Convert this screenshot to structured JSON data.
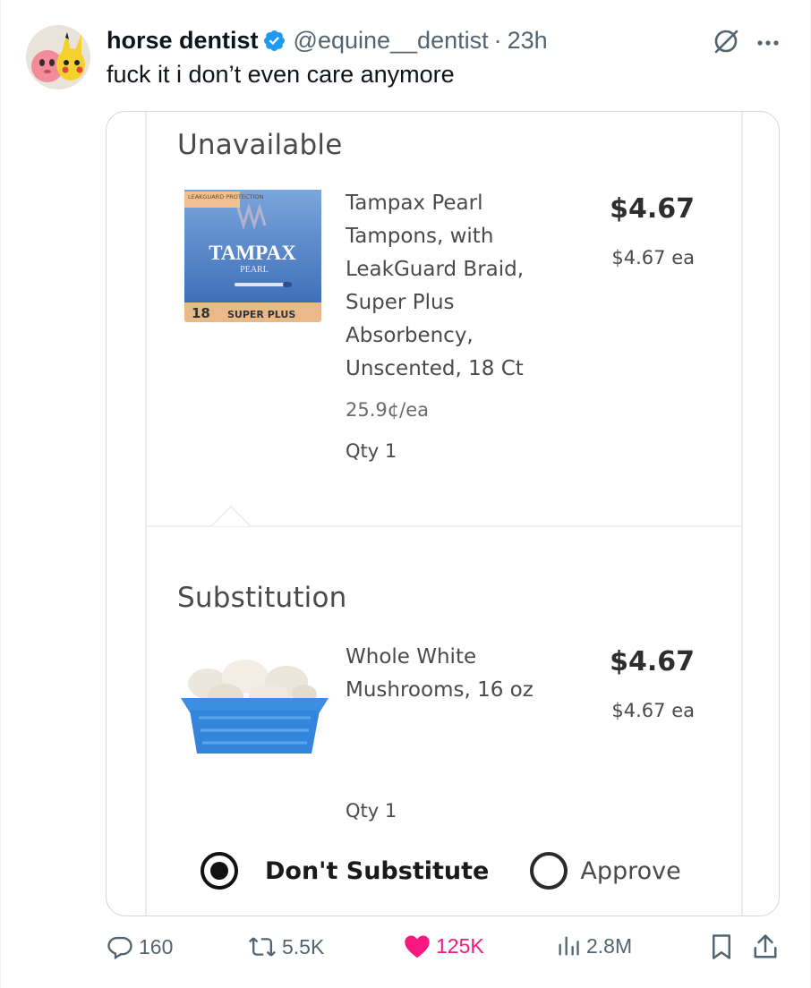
{
  "tweet": {
    "display_name": "horse dentist",
    "handle": "@equine__dentist",
    "separator": "·",
    "time": "23h",
    "text": "fuck it i don’t even care anymore"
  },
  "screenshot": {
    "unavailable": {
      "section_title": "Unavailable",
      "product_name": "Tampax Pearl Tampons, with LeakGuard Braid, Super Plus Absorbency, Unscented, 18 Ct",
      "price": "$4.67",
      "price_each": "$4.67 ea",
      "unit_price": "25.9¢/ea",
      "qty": "Qty 1",
      "box_text": {
        "brand": "TAMPAX",
        "variant": "PEARL",
        "leakguard": "LEAKGUARD PROTECTION",
        "count": "18",
        "size": "SUPER PLUS"
      }
    },
    "substitution": {
      "section_title": "Substitution",
      "product_name": "Whole White Mushrooms, 16 oz",
      "price": "$4.67",
      "price_each": "$4.67 ea",
      "qty": "Qty 1"
    },
    "options": {
      "selected": "Don't Substitute",
      "dont_substitute": "Don't Substitute",
      "approve": "Approve"
    }
  },
  "actions": {
    "replies": "160",
    "reposts": "5.5K",
    "likes": "125K",
    "views": "2.8M",
    "liked": true
  },
  "colors": {
    "like_pink": "#f91880",
    "verified_blue": "#1d9bf0",
    "muted_gray": "#536471",
    "tampax_blue": "#4a7fc1",
    "basket_blue": "#3b8fe0"
  },
  "icons": [
    "verified-badge-icon",
    "grok-icon",
    "more-icon",
    "reply-icon",
    "repost-icon",
    "heart-icon",
    "views-icon",
    "bookmark-icon",
    "share-icon"
  ]
}
